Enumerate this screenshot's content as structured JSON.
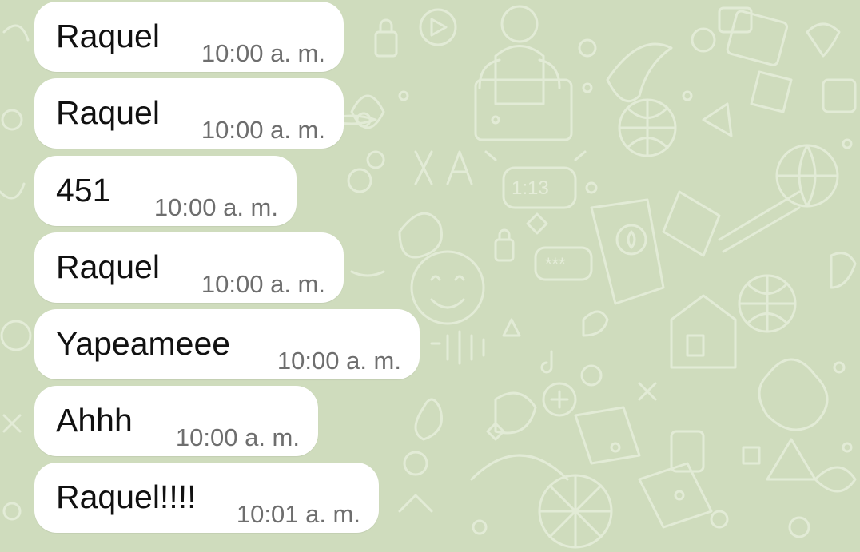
{
  "wallpaper": {
    "background_color": "#cfdcbd",
    "doodle_color": "#e6eedb",
    "doodle_text_clock": "1:13",
    "doodle_text_password": "***"
  },
  "messages": [
    {
      "text": "Raquel",
      "time": "10:00 a. m."
    },
    {
      "text": "Raquel",
      "time": "10:00 a. m."
    },
    {
      "text": "451",
      "time": "10:00 a. m."
    },
    {
      "text": "Raquel",
      "time": "10:00 a. m."
    },
    {
      "text": "Yapeameee",
      "time": "10:00 a. m."
    },
    {
      "text": "Ahhh",
      "time": "10:00 a. m."
    },
    {
      "text": "Raquel!!!!",
      "time": "10:01 a. m."
    }
  ]
}
